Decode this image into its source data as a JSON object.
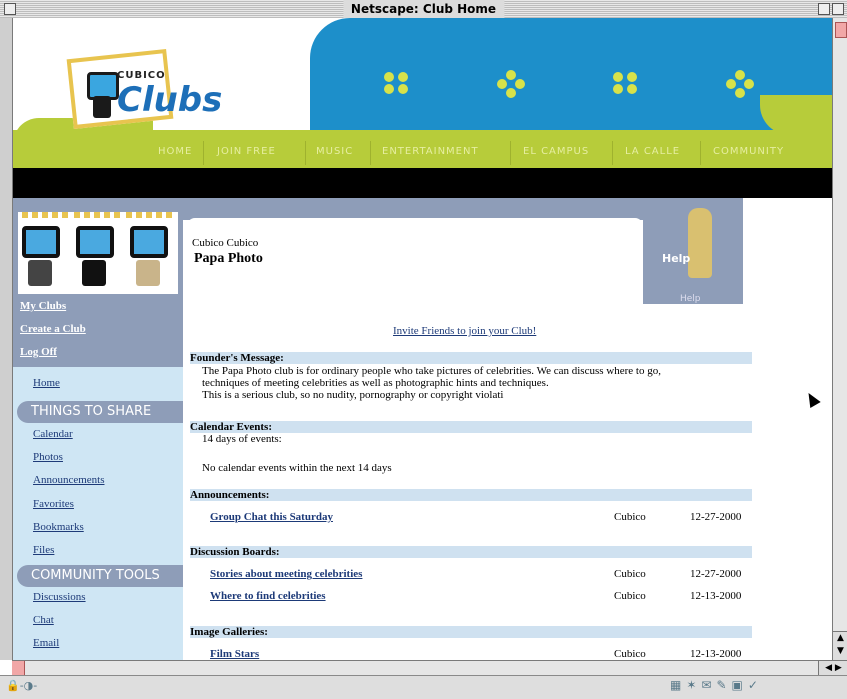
{
  "window": {
    "title": "Netscape: Club Home"
  },
  "logo": {
    "brand_small": "CUBICO",
    "brand_large": "Clubs"
  },
  "nav": [
    "HOME",
    "JOIN FREE",
    "MUSIC",
    "ENTERTAINMENT",
    "EL CAMPUS",
    "LA CALLE",
    "COMMUNITY"
  ],
  "sidebar": {
    "top_links": [
      "My Clubs",
      "Create a Club",
      "Log Off"
    ],
    "home": "Home",
    "section_share": "THINGS TO SHARE",
    "share_links": [
      "Calendar",
      "Photos",
      "Announcements",
      "Favorites",
      "Bookmarks",
      "Files"
    ],
    "section_community": "COMMUNITY TOOLS",
    "community_links": [
      "Discussions",
      "Chat",
      "Email"
    ]
  },
  "club": {
    "owner": "Cubico Cubico",
    "name": "Papa Photo"
  },
  "help": {
    "label": "Help",
    "caption": "Help"
  },
  "invite_link": "Invite Friends to join your Club!",
  "founders": {
    "header": "Founder's Message:",
    "lines": [
      "The Papa Photo club is for ordinary people who take pictures of celebrities. We can discuss where to go,",
      "techniques of meeting celebrities as well as photographic hints and techniques.",
      "This is a serious club, so no nudity, pornography or copyright violati"
    ]
  },
  "calendar": {
    "header": "Calendar Events:",
    "subtitle": "14 days of events:",
    "empty": "No calendar events within the next 14 days"
  },
  "announcements": {
    "header": "Announcements:",
    "items": [
      {
        "title": "Group Chat this Saturday",
        "author": "Cubico",
        "date": "12-27-2000"
      }
    ]
  },
  "discussions": {
    "header": "Discussion Boards:",
    "items": [
      {
        "title": "Stories about meeting celebrities",
        "author": "Cubico",
        "date": "12-27-2000"
      },
      {
        "title": "Where to find celebrities",
        "author": "Cubico",
        "date": "12-13-2000"
      }
    ]
  },
  "galleries": {
    "header": "Image Galleries:",
    "items": [
      {
        "title": "Film Stars",
        "author": "Cubico",
        "date": "12-13-2000"
      }
    ]
  },
  "colors": {
    "blue": "#1d8fca",
    "green": "#b7cc3a",
    "sidebar": "#8e9db8",
    "section": "#cfe1f0"
  },
  "icons": [
    "security-icon",
    "connection-icon",
    "mail-icon",
    "composer-icon",
    "taskbar-icon"
  ]
}
